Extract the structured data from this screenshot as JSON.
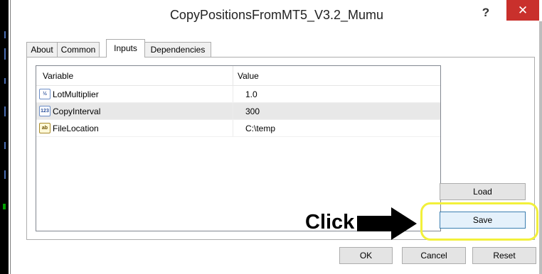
{
  "window": {
    "title": "CopyPositionsFromMT5_V3.2_Mumu",
    "help_glyph": "?",
    "close_glyph": "✕"
  },
  "tabs": [
    {
      "label": "About"
    },
    {
      "label": "Common"
    },
    {
      "label": "Inputs",
      "active": true
    },
    {
      "label": "Dependencies"
    }
  ],
  "grid": {
    "columns": {
      "variable": "Variable",
      "value": "Value"
    },
    "rows": [
      {
        "icon": "fraction-type-icon",
        "icon_text": "½",
        "name": "LotMultiplier",
        "value": "1.0"
      },
      {
        "icon": "integer-type-icon",
        "icon_text": "123",
        "name": "CopyInterval",
        "value": "300",
        "selected": true
      },
      {
        "icon": "string-type-icon",
        "icon_text": "ab",
        "name": "FileLocation",
        "value": "C:\\temp"
      }
    ]
  },
  "buttons": {
    "load": "Load",
    "save": "Save",
    "ok": "OK",
    "cancel": "Cancel",
    "reset": "Reset"
  },
  "annotation": {
    "text": "Click",
    "highlight_color": "#f2f03a",
    "arrow_color": "#000000"
  },
  "colors": {
    "close_button": "#c9302c",
    "selected_row": "#e8e8e8"
  }
}
